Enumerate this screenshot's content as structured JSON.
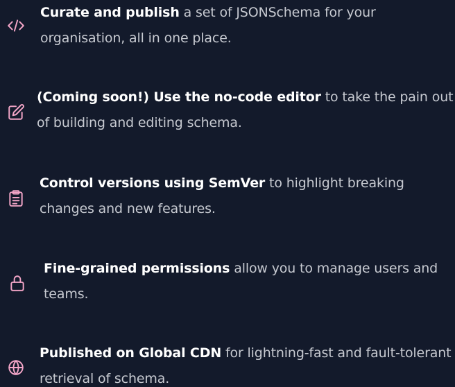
{
  "features": [
    {
      "icon": "code-icon",
      "bold": "Curate and publish",
      "line1_rest": " a set of JSONSchema for your",
      "line2": "organisation, all in one place."
    },
    {
      "icon": "edit-icon",
      "bold": "(Coming soon!) Use the no-code editor",
      "line1_rest": " to take the pain out",
      "line2": "of building and editing schema."
    },
    {
      "icon": "clipboard-icon",
      "bold": "Control versions using SemVer",
      "line1_rest": " to highlight breaking",
      "line2": "changes and new features."
    },
    {
      "icon": "lock-icon",
      "bold": "Fine-grained permissions",
      "line1_rest": " allow you to manage users and",
      "line2": "teams."
    },
    {
      "icon": "globe-icon",
      "bold": "Published on Global CDN",
      "line1_rest": " for lightning-fast and fault-tolerant",
      "line2": "retrieval of schema."
    }
  ],
  "colors": {
    "background": "#131a2b",
    "icon_accent": "#f4a6c8",
    "bold_text": "#ffffff",
    "body_text": "#c7cad1"
  }
}
